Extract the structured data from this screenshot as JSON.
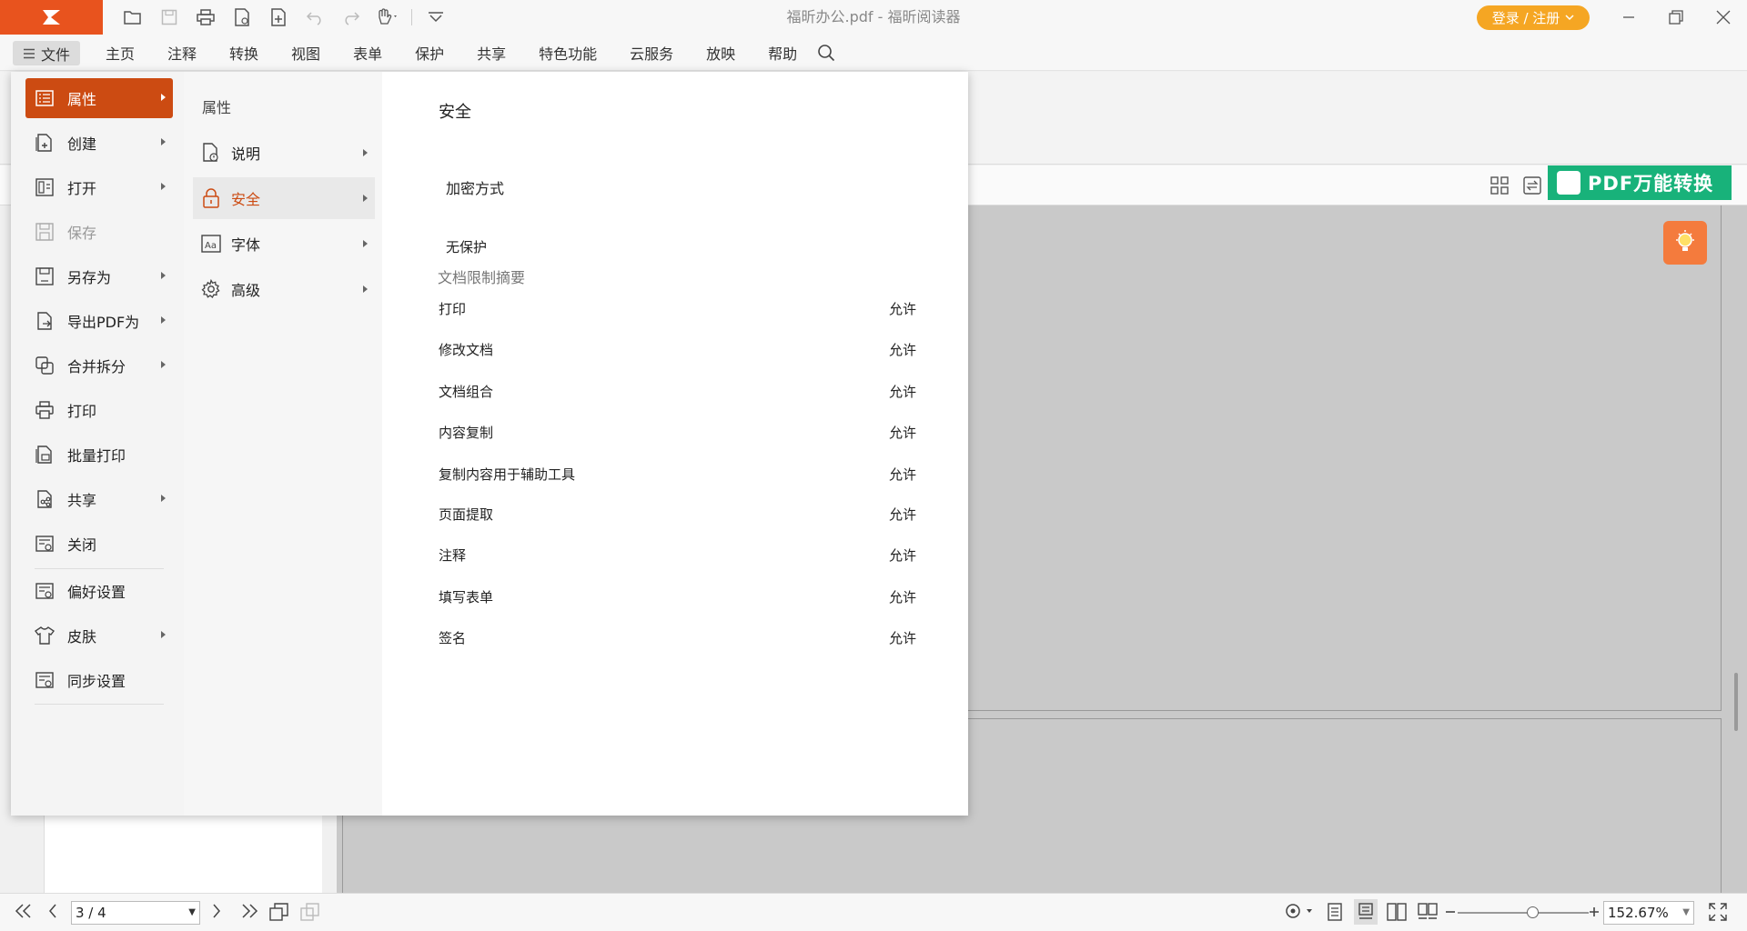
{
  "app": {
    "title": "福昕办公.pdf - 福昕阅读器",
    "login_label": "登录 / 注册"
  },
  "menubar": {
    "file_label": "文件",
    "tabs": [
      "主页",
      "注释",
      "转换",
      "视图",
      "表单",
      "保护",
      "共享",
      "特色功能",
      "云服务",
      "放映",
      "帮助"
    ]
  },
  "promo": {
    "label": "PDF万能转换"
  },
  "file_menu": {
    "items": [
      {
        "label": "属性"
      },
      {
        "label": "创建"
      },
      {
        "label": "打开"
      },
      {
        "label": "保存"
      },
      {
        "label": "另存为"
      },
      {
        "label": "导出PDF为"
      },
      {
        "label": "合并拆分"
      },
      {
        "label": "打印"
      },
      {
        "label": "批量打印"
      },
      {
        "label": "共享"
      },
      {
        "label": "关闭"
      },
      {
        "label": "偏好设置"
      },
      {
        "label": "皮肤"
      },
      {
        "label": "同步设置"
      }
    ]
  },
  "properties": {
    "heading": "属性",
    "items": [
      {
        "label": "说明"
      },
      {
        "label": "安全"
      },
      {
        "label": "字体"
      },
      {
        "label": "高级"
      }
    ]
  },
  "security": {
    "title": "安全",
    "encryption_label": "加密方式",
    "encryption_value": "无保护",
    "summary_label": "文档限制摘要",
    "permissions": [
      {
        "name": "打印",
        "value": "允许"
      },
      {
        "name": "修改文档",
        "value": "允许"
      },
      {
        "name": "文档组合",
        "value": "允许"
      },
      {
        "name": "内容复制",
        "value": "允许"
      },
      {
        "name": "复制内容用于辅助工具",
        "value": "允许"
      },
      {
        "name": "页面提取",
        "value": "允许"
      },
      {
        "name": "注释",
        "value": "允许"
      },
      {
        "name": "填写表单",
        "value": "允许"
      },
      {
        "name": "签名",
        "value": "允许"
      }
    ]
  },
  "statusbar": {
    "page_value": "3 / 4",
    "zoom_value": "152.67%"
  },
  "colors": {
    "brand": "#e8531e",
    "active": "#cc4b12",
    "login": "#f5a623",
    "promo": "#18b27a",
    "tip": "#f47b3d"
  }
}
